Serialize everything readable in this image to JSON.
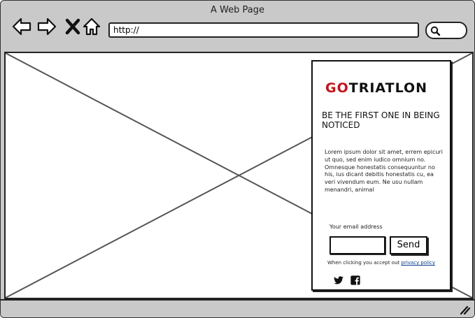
{
  "window": {
    "title": "A Web Page"
  },
  "toolbar": {
    "url_value": "http://",
    "icons": [
      "back-arrow-icon",
      "forward-arrow-icon",
      "close-x-icon",
      "home-icon",
      "search-icon"
    ]
  },
  "panel": {
    "brand_go": "GO",
    "brand_rest": "TRIATLON",
    "heading": "BE THE FIRST ONE IN BEING NOTICED",
    "body": "Lorem ipsum dolor sit amet, errem epicuri ut quo, sed enim iudico omnium no. Omnesque honestatis consequuntur no his, ius dicant debitis honestatis cu, ea veri vivendum eum. Ne usu nullam menandri, animal",
    "email_label": "Your email address",
    "email_value": "",
    "send_label": "Send",
    "notice_text": "When clicking you accept out",
    "privacy_link": "privacy policy",
    "social_icons": [
      "twitter-icon",
      "facebook-icon"
    ]
  },
  "colors": {
    "brand_accent": "#c0161c",
    "link": "#0a3c8c",
    "chrome": "#c9c9c9"
  }
}
